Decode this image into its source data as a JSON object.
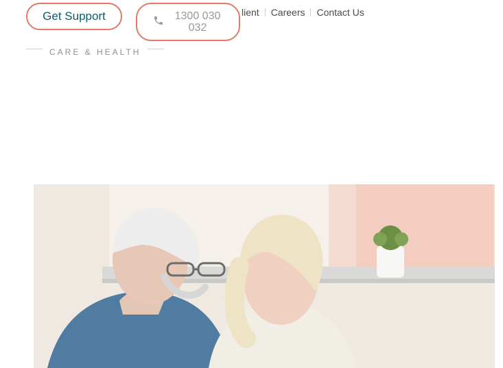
{
  "nav": {
    "items": [
      "lient",
      "Careers",
      "Contact Us"
    ]
  },
  "buttons": {
    "get_support_label": "Get Support",
    "phone_line1": "1300 030",
    "phone_line2": "032"
  },
  "tagline": {
    "text": "CARE & HEALTH"
  },
  "hero": {
    "icon": "hero-photo"
  },
  "colors": {
    "accent_border": "#e07a66",
    "primary_text": "#0c5b68",
    "muted_text": "#9a9a9a"
  }
}
